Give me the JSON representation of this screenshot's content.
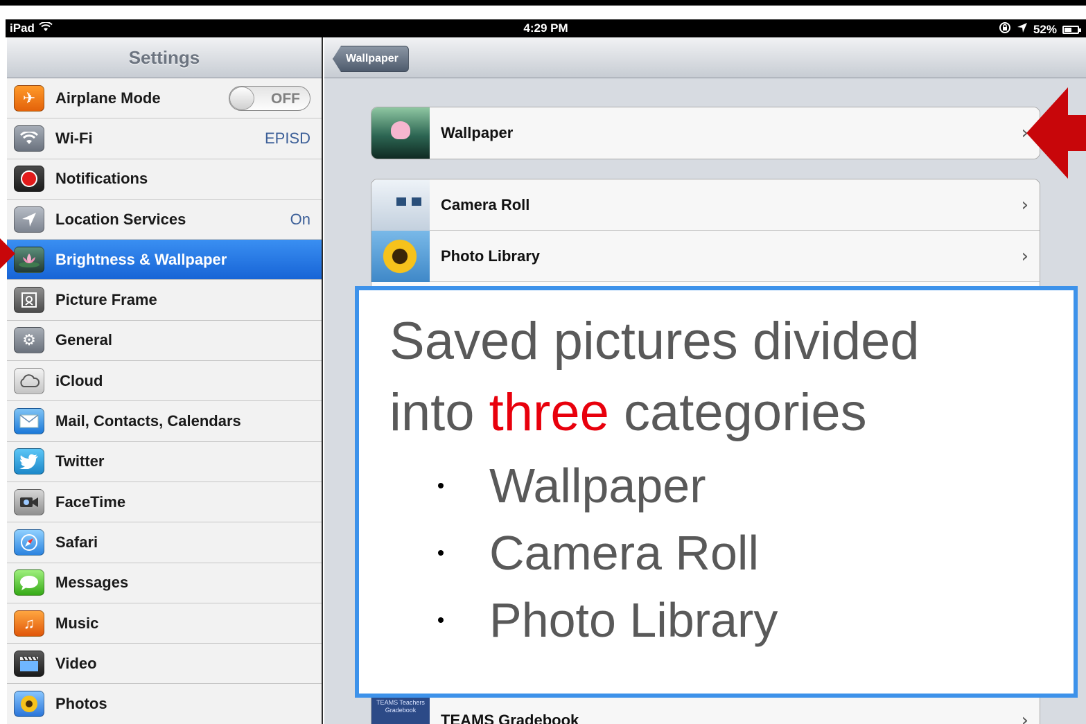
{
  "status_bar": {
    "device": "iPad",
    "time": "4:29 PM",
    "battery": "52%"
  },
  "sidebar": {
    "title": "Settings",
    "items": [
      {
        "label": "Airplane Mode",
        "toggle": "OFF",
        "icon": "airplane-icon"
      },
      {
        "label": "Wi-Fi",
        "value": "EPISD",
        "icon": "wifi-icon"
      },
      {
        "label": "Notifications",
        "icon": "notifications-icon"
      },
      {
        "label": "Location Services",
        "value": "On",
        "icon": "location-arrow-icon"
      },
      {
        "label": "Brightness & Wallpaper",
        "selected": true,
        "icon": "lotus-flower-icon"
      },
      {
        "label": "Picture Frame",
        "icon": "picture-frame-icon"
      },
      {
        "label": "General",
        "icon": "gear-icon"
      },
      {
        "label": "iCloud",
        "icon": "cloud-icon"
      },
      {
        "label": "Mail, Contacts, Calendars",
        "icon": "envelope-icon"
      },
      {
        "label": "Twitter",
        "icon": "bird-icon"
      },
      {
        "label": "FaceTime",
        "icon": "video-camera-icon"
      },
      {
        "label": "Safari",
        "icon": "compass-icon"
      },
      {
        "label": "Messages",
        "icon": "speech-bubble-icon"
      },
      {
        "label": "Music",
        "icon": "music-note-icon"
      },
      {
        "label": "Video",
        "icon": "film-clapper-icon"
      },
      {
        "label": "Photos",
        "icon": "sunflower-icon"
      }
    ]
  },
  "detail": {
    "back_button": "Wallpaper",
    "wallpaper_row": "Wallpaper",
    "albums": [
      {
        "label": "Camera Roll"
      },
      {
        "label": "Photo Library"
      },
      {
        "label": "TEAMS Gradebook",
        "thumb_text": "TEAMS Teachers Gradebook"
      }
    ]
  },
  "overlay": {
    "line1": "Saved pictures divided",
    "line2_before": "into ",
    "line2_highlight": "three",
    "line2_after": " categories",
    "bullets": [
      "Wallpaper",
      "Camera Roll",
      "Photo Library"
    ]
  },
  "colors": {
    "selected_row": "#1a6ad9",
    "highlight_text": "#e8000c",
    "overlay_border": "#3d92ea",
    "arrow": "#c8060a"
  }
}
